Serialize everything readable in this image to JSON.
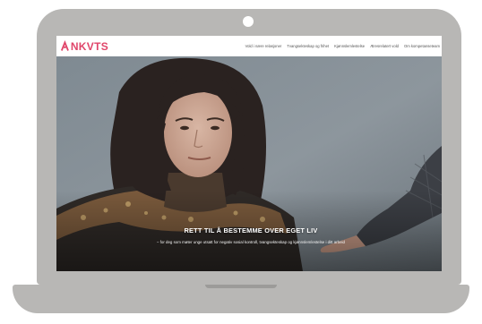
{
  "site": {
    "logo_text": "NKVTS",
    "brand_color": "#e0456a"
  },
  "nav": {
    "items": [
      {
        "label": "Vold i nære relasjoner"
      },
      {
        "label": "Tvangsekteskap og frihet"
      },
      {
        "label": "Kjønnslemlestelse"
      },
      {
        "label": "Æresrelatert vold"
      },
      {
        "label": "Om kompetanseteam"
      }
    ]
  },
  "hero": {
    "title": "RETT TIL Å BESTEMME OVER EGET LIV",
    "subtitle": "– for deg som møter unge utsatt for negativ sosial kontroll, tvangsekteskap og kjønnslemlestelse i ditt arbeid"
  },
  "icons": {
    "logo": "nkvts-logo-icon"
  }
}
